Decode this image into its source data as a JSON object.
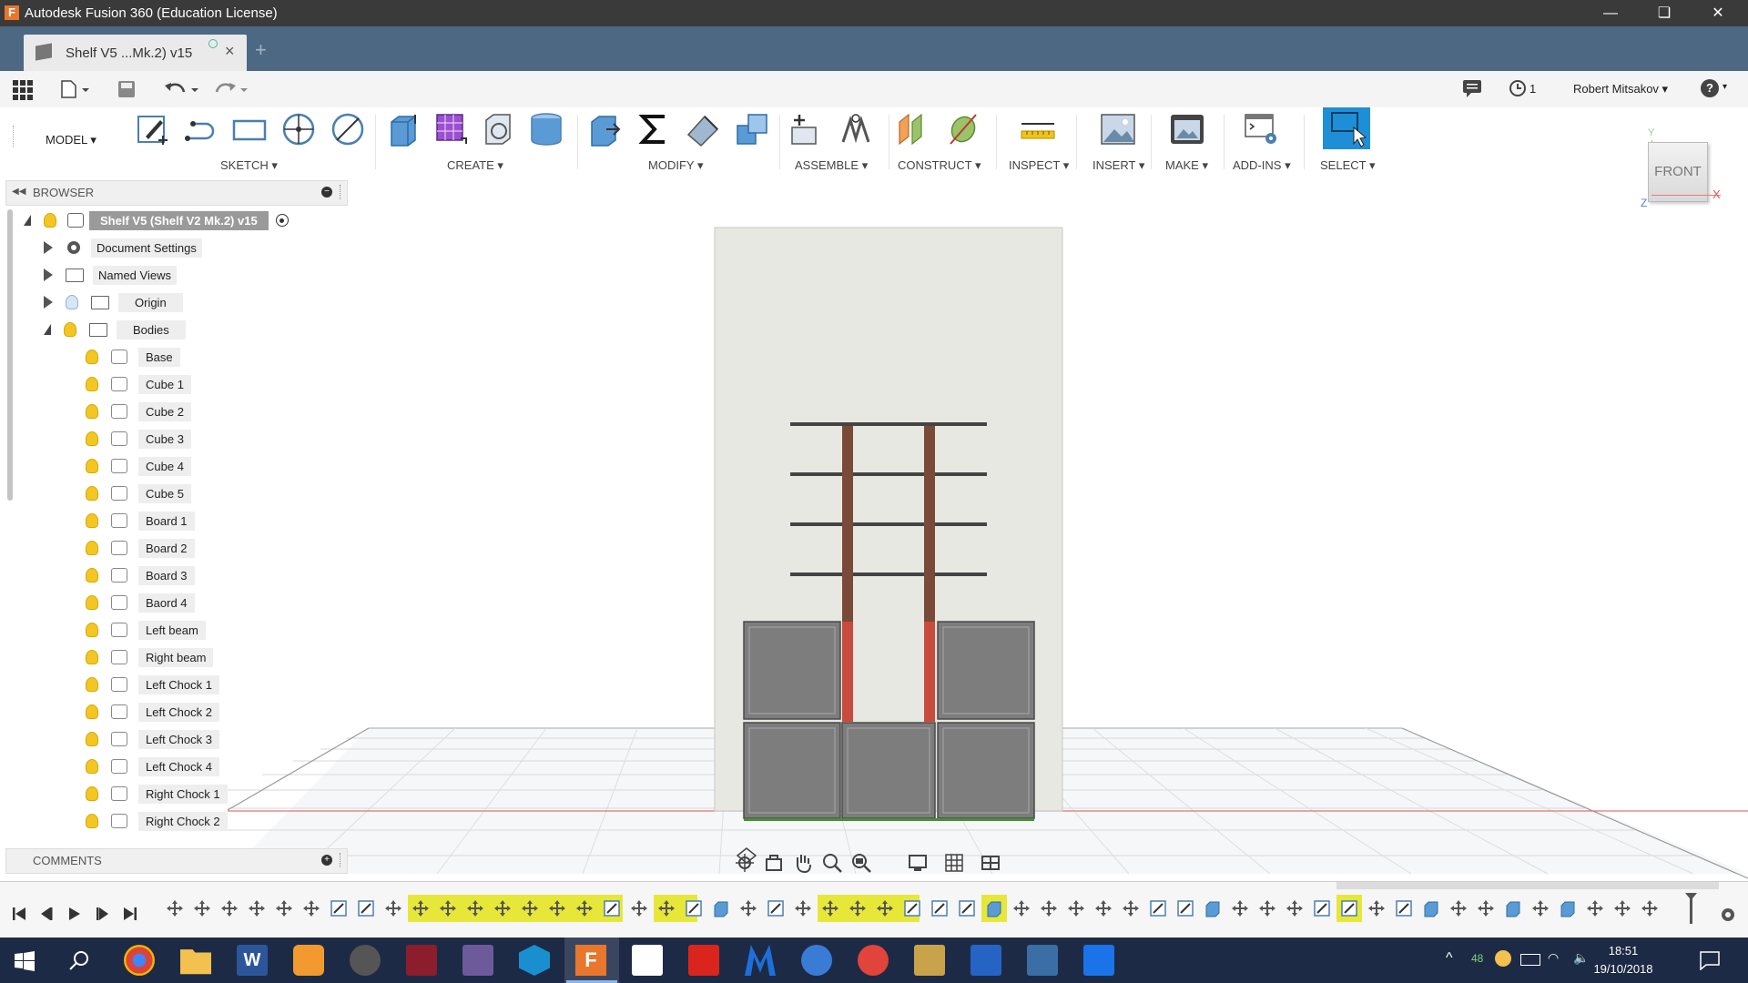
{
  "window": {
    "title": "Autodesk Fusion 360 (Education License)",
    "logo_letter": "F"
  },
  "tab": {
    "label": "Shelf V5 ...Mk.2) v15",
    "close": "×",
    "new_tab": "+"
  },
  "quick_access": {
    "job_status_count": "1",
    "user": "Robert Mitsakov",
    "help": "?"
  },
  "workspace": {
    "label": "MODEL"
  },
  "ribbon_groups": [
    {
      "label": "SKETCH"
    },
    {
      "label": "CREATE"
    },
    {
      "label": "MODIFY"
    },
    {
      "label": "ASSEMBLE"
    },
    {
      "label": "CONSTRUCT"
    },
    {
      "label": "INSPECT"
    },
    {
      "label": "INSERT"
    },
    {
      "label": "MAKE"
    },
    {
      "label": "ADD-INS"
    },
    {
      "label": "SELECT"
    }
  ],
  "viewcube": {
    "face": "FRONT",
    "axis_y": "Y",
    "axis_x": "X",
    "axis_z": "Z"
  },
  "browser": {
    "title": "BROWSER",
    "root": "Shelf V5 (Shelf V2 Mk.2) v15",
    "folders": [
      {
        "label": "Document Settings"
      },
      {
        "label": "Named Views"
      },
      {
        "label": "Origin"
      },
      {
        "label": "Bodies"
      }
    ],
    "bodies": [
      "Base",
      "Cube 1",
      "Cube 2",
      "Cube 3",
      "Cube 4",
      "Cube 5",
      "Board 1",
      "Board 2",
      "Board 3",
      "Baord 4",
      "Left beam",
      "Right beam",
      "Left Chock 1",
      "Left Chock 2",
      "Left Chock 3",
      "Left Chock 4",
      "Right Chock 1",
      "Right Chock 2"
    ]
  },
  "comments": {
    "title": "COMMENTS"
  },
  "taskbar": {
    "time": "18:51",
    "date": "19/10/2018",
    "battery_pct": "48"
  },
  "colors": {
    "titlebar": "#3a3a3a",
    "tabbar": "#4d6882",
    "select_blue": "#1e8fd6",
    "beam_red": "#c94b3d",
    "timeline_yellow": "#e7e73a"
  }
}
